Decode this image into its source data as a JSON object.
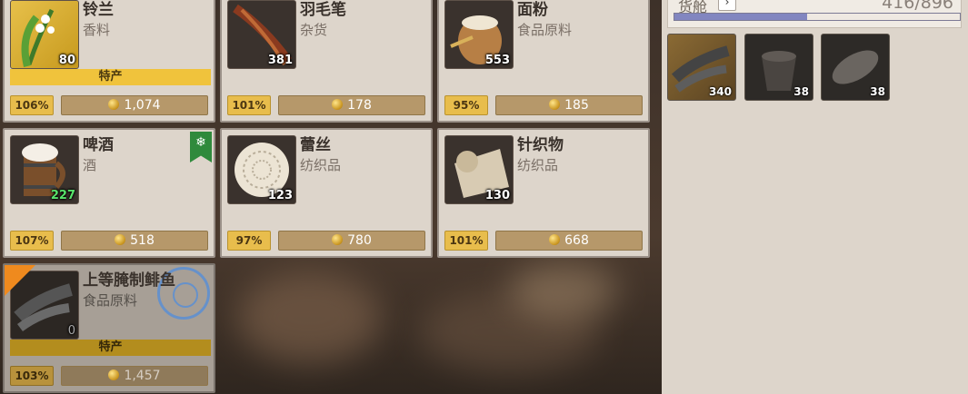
{
  "cards": [
    {
      "name": "铃兰",
      "category": "香料",
      "qty": "80",
      "special": "特产",
      "pct": "106%",
      "price": "1,074",
      "icon": "lily-of-valley-icon"
    },
    {
      "name": "羽毛笔",
      "category": "杂货",
      "qty": "381",
      "pct": "101%",
      "price": "178",
      "icon": "quill-icon"
    },
    {
      "name": "面粉",
      "category": "食品原料",
      "qty": "553",
      "pct": "95%",
      "price": "185",
      "icon": "flour-sack-icon"
    },
    {
      "name": "啤酒",
      "category": "酒",
      "qty": "227",
      "pct": "107%",
      "price": "518",
      "icon": "beer-mug-icon",
      "badge": "snowflake-icon"
    },
    {
      "name": "蕾丝",
      "category": "纺织品",
      "qty": "123",
      "pct": "97%",
      "price": "780",
      "icon": "lace-icon"
    },
    {
      "name": "针织物",
      "category": "纺织品",
      "qty": "130",
      "pct": "101%",
      "price": "668",
      "icon": "knitwear-icon"
    },
    {
      "name": "上等腌制鲱鱼",
      "category": "食品原料",
      "qty": "0",
      "special": "特产",
      "pct": "103%",
      "price": "1,457",
      "icon": "salted-herring-icon"
    }
  ],
  "side": {
    "label": "货舱",
    "count": "416/896",
    "fill_fraction": 0.466,
    "items": [
      {
        "qty": "340",
        "icon": "salted-herring-icon"
      },
      {
        "qty": "38",
        "icon": "wooden-bucket-icon"
      },
      {
        "qty": "38",
        "icon": "bread-icon"
      }
    ]
  },
  "colors": {
    "panel": "#ddd5cb",
    "special": "#f0c33c",
    "price": "#b6986a",
    "pct": "#e8bd4c",
    "bar": "#8286c0"
  }
}
